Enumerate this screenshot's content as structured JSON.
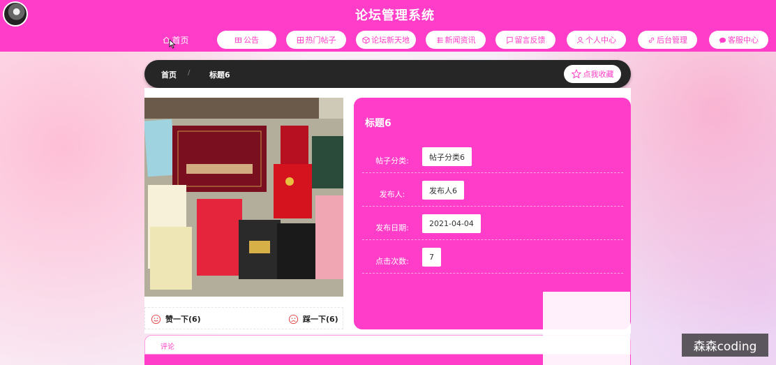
{
  "header": {
    "title": "论坛管理系统"
  },
  "nav": [
    {
      "label": "首页",
      "icon": "home-icon"
    },
    {
      "label": "公告",
      "icon": "notice-icon"
    },
    {
      "label": "热门帖子",
      "icon": "hot-posts-icon"
    },
    {
      "label": "论坛新天地",
      "icon": "forum-icon"
    },
    {
      "label": "新闻资讯",
      "icon": "news-icon"
    },
    {
      "label": "留言反馈",
      "icon": "message-icon"
    },
    {
      "label": "个人中心",
      "icon": "user-icon"
    },
    {
      "label": "后台管理",
      "icon": "link-icon"
    },
    {
      "label": "客服中心",
      "icon": "chat-icon"
    }
  ],
  "breadcrumb": {
    "home": "首页",
    "separator": "/",
    "current": "标题6"
  },
  "favorite": {
    "label": "点我收藏",
    "icon": "star-icon"
  },
  "post": {
    "title": "标题6",
    "fields": [
      {
        "label": "帖子分类:",
        "value": "帖子分类6"
      },
      {
        "label": "发布人:",
        "value": "发布人6"
      },
      {
        "label": "发布日期:",
        "value": "2021-04-04"
      },
      {
        "label": "点击次数:",
        "value": "7"
      }
    ]
  },
  "votes": {
    "like": "赞一下(6)",
    "dislike": "踩一下(6)"
  },
  "comment": {
    "label": "评论"
  },
  "watermark": "森森coding",
  "colors": {
    "accent": "#ff3dc8",
    "breadcrumb_bg": "#262626"
  }
}
